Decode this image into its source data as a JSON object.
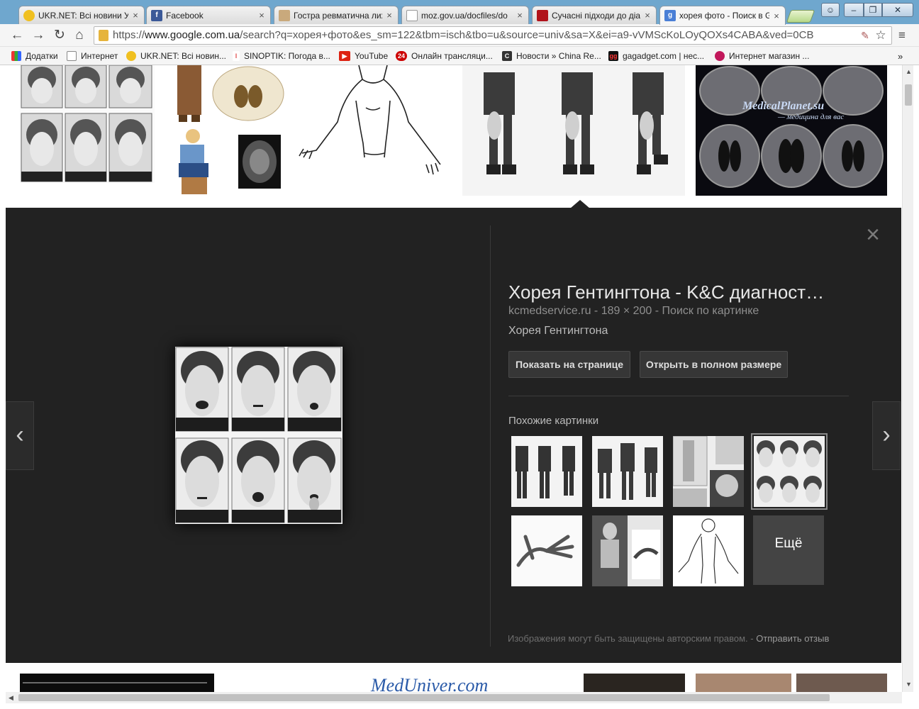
{
  "tabs": [
    {
      "title": "UKR.NET: Всі новини Ук",
      "icon": "ukrnet-icon"
    },
    {
      "title": "Facebook",
      "icon": "facebook-icon"
    },
    {
      "title": "Гостра ревматична лих",
      "icon": "doc-icon"
    },
    {
      "title": "moz.gov.ua/docfiles/do",
      "icon": "page-icon"
    },
    {
      "title": "Сучасні підходи до діаг",
      "icon": "red-icon"
    },
    {
      "title": "хорея фото - Поиск в G",
      "icon": "google-icon"
    }
  ],
  "url": {
    "scheme": "https://",
    "host": "www.google.com.ua",
    "path": "/search?q=хорея+фото&es_sm=122&tbm=isch&tbo=u&source=univ&sa=X&ei=a9-vVMScKoLOyQOXs4CABA&ved=0CB"
  },
  "bookmarks": [
    {
      "label": "Додатки",
      "icon": "apps-icon"
    },
    {
      "label": "Интернет",
      "icon": "folder-icon"
    },
    {
      "label": "UKR.NET: Всі новин...",
      "icon": "ukrnet-icon"
    },
    {
      "label": "SINOPTIK: Погода в...",
      "icon": "thermometer-icon"
    },
    {
      "label": "YouTube",
      "icon": "youtube-icon"
    },
    {
      "label": "Онлайн трансляци...",
      "icon": "tv24-icon"
    },
    {
      "label": "Новости » China Re...",
      "icon": "china-icon"
    },
    {
      "label": "gagadget.com | нес...",
      "icon": "gagadget-icon"
    },
    {
      "label": "Интернет магазин ...",
      "icon": "shop-icon"
    }
  ],
  "bookmarks_more": "»",
  "panel": {
    "title": "Хорея Гентингтона - K&C диагност…",
    "source": "kcmedservice.ru",
    "dims": "189 × 200",
    "search_by_image": "Поиск по картинке",
    "meta_sep": " - ",
    "subtitle": "Хорея Гентингтона",
    "btn_show": "Показать на странице",
    "btn_open": "Открыть в полном размере",
    "similar_title": "Похожие картинки",
    "more_label": "Ещё",
    "copyright": "Изображения могут быть защищены авторским правом.",
    "feedback_sep": " - ",
    "feedback": "Отправить отзыв",
    "close_glyph": "×",
    "prev_glyph": "‹",
    "next_glyph": "›"
  },
  "thumbnail_text": {
    "medplanet": "MedicalPlanet.su",
    "medplanet_sub": "— медицина для вас",
    "meduniver": "MedUniver.com"
  },
  "colors": {
    "panel_bg": "#222222",
    "chrome_frame": "#6fa7ce",
    "title_text": "#e8e8e8"
  }
}
